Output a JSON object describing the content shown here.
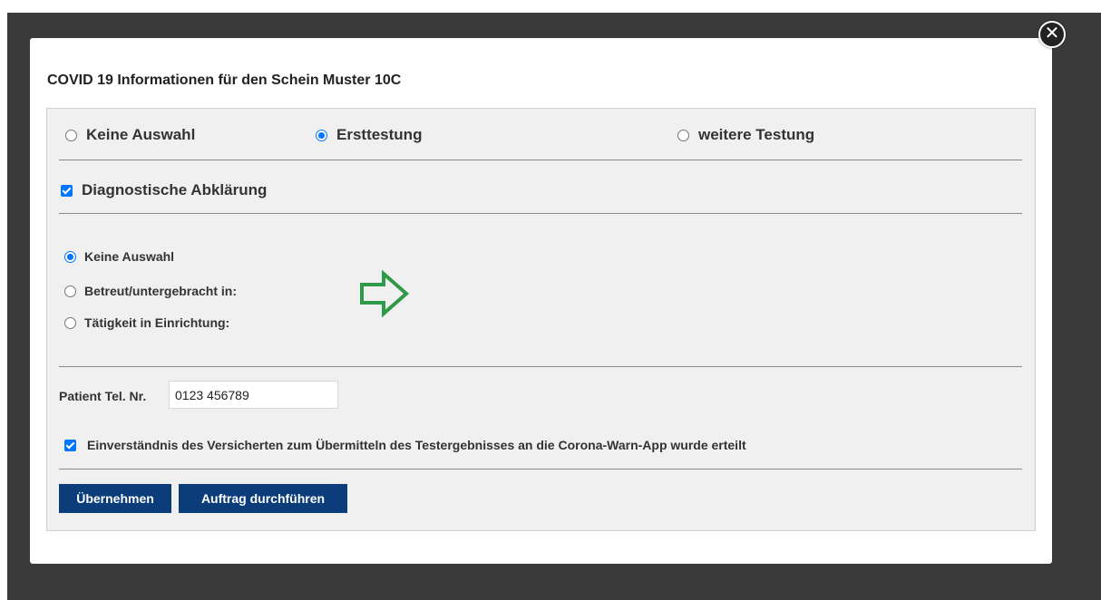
{
  "close_icon": "close-icon",
  "dialog": {
    "title": "COVID 19 Informationen für den Schein Muster 10C"
  },
  "test_type": {
    "options": [
      "Keine Auswahl",
      "Ersttestung",
      "weitere Testung"
    ],
    "selected": "Ersttestung"
  },
  "diagnostic": {
    "label": "Diagnostische Abklärung",
    "checked": true
  },
  "facility": {
    "options": [
      "Keine Auswahl",
      "Betreut/untergebracht in:",
      "Tätigkeit in Einrichtung:"
    ],
    "selected": "Keine Auswahl"
  },
  "arrow_icon": "right-arrow-icon",
  "arrow_color": "#2e9a4a",
  "patient_tel": {
    "label": "Patient Tel. Nr.",
    "value": "0123 456789"
  },
  "consent": {
    "label": "Einverständnis des Versicherten zum Übermitteln des Testergebnisses an die Corona-Warn-App wurde erteilt",
    "checked": true
  },
  "buttons": {
    "apply": "Übernehmen",
    "execute": "Auftrag durchführen"
  },
  "colors": {
    "accent": "#0075ff",
    "button": "#0a3d7a",
    "overlay": "#3a3a3a"
  }
}
